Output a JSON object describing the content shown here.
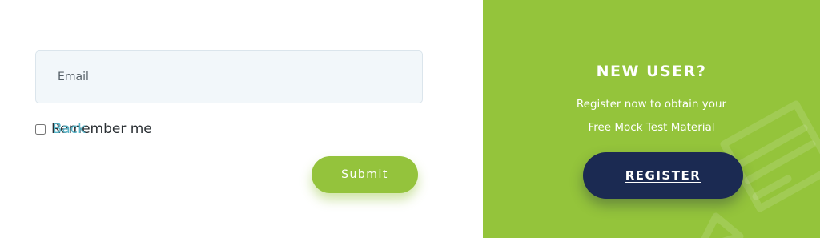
{
  "login": {
    "email_placeholder": "Email",
    "remember_label": "Remember me",
    "remember_checked": false,
    "back_label": "Back",
    "submit_label": "Submit"
  },
  "register_panel": {
    "heading": "NEW USER?",
    "line1": "Register now to obtain your",
    "line2": "Free Mock Test Material",
    "button_label": "REGISTER",
    "background_color": "#94c43b",
    "button_color": "#1b2a52"
  },
  "colors": {
    "submit_button": "#94c33c",
    "back_link": "#58b4c8",
    "email_field_bg": "#f2f7fa"
  },
  "icons": [
    "checkbox-icon",
    "pencil-paper-decoration-icon"
  ]
}
